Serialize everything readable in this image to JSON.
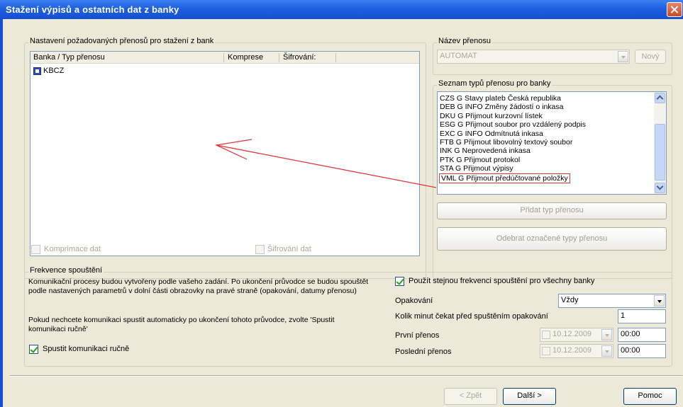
{
  "window": {
    "title": "Stažení výpisů a ostatních dat z banky"
  },
  "transfers_group": {
    "label": "Nastavení požadovaných přenosů pro stažení z bank",
    "columns": [
      "Banka / Typ přenosu",
      "Komprese",
      "Šifrování:"
    ],
    "rows": [
      {
        "name": "KBCZ",
        "icon": "bank-tree-icon"
      }
    ],
    "compression_label": "Komprimace dat",
    "encryption_label": "Šifrování dat"
  },
  "transfer_name": {
    "label": "Název přenosu",
    "value": "AUTOMAT",
    "new_button": "Nový"
  },
  "types_list": {
    "label": "Seznam typů přenosu pro banky",
    "items": [
      "CZS G Stavy plateb Česká republika",
      "DEB G INFO Změny žádostí o inkasa",
      "DKU G Přijmout kurzovní lístek",
      "ESG G Přijmout soubor pro vzdálený podpis",
      "EXC G INFO Odmítnutá inkasa",
      "FTB G Přijmout libovolný textový soubor",
      "INK G Neprovedená inkasa",
      "PTK G Přijmout protokol",
      "STA G Přijmout výpisy",
      "VML G Přijmout předúčtované položky"
    ],
    "highlighted_index": 9,
    "add_button": "Přidat typ přenosu",
    "remove_button": "Odebrat označené typy přenosu"
  },
  "frequency": {
    "label": "Frekvence spouštění",
    "desc1": "Komunikační procesy budou vytvořeny podle vašeho zadání. Po ukončení průvodce se budou spouštět podle nastavených parametrů v dolní části obrazovky na pravé straně (opakování, datumy přenosu)",
    "desc2": "Pokud nechcete komunikaci spustit automaticky po ukončení tohoto průvodce, zvolte 'Spustit komunikaci ručně'",
    "manual_label": "Spustit komunikaci ručně",
    "same_freq_label": "Použít stejnou frekvenci spouštění pro všechny banky",
    "repeat_label": "Opakování",
    "repeat_value": "Vždy",
    "minutes_label": "Kolik minut čekat před spuštěním opakování",
    "minutes_value": "1",
    "first_label": "První přenos",
    "first_date": "10.12.2009",
    "first_time": "00:00",
    "last_label": "Poslední přenos",
    "last_date": "10.12.2009",
    "last_time": "00:00"
  },
  "nav": {
    "back": "< Zpět",
    "next": "Další >",
    "help": "Pomoc"
  },
  "colors": {
    "annotation_arrow": "#E03030",
    "titlebar": "#1F5FE0"
  }
}
